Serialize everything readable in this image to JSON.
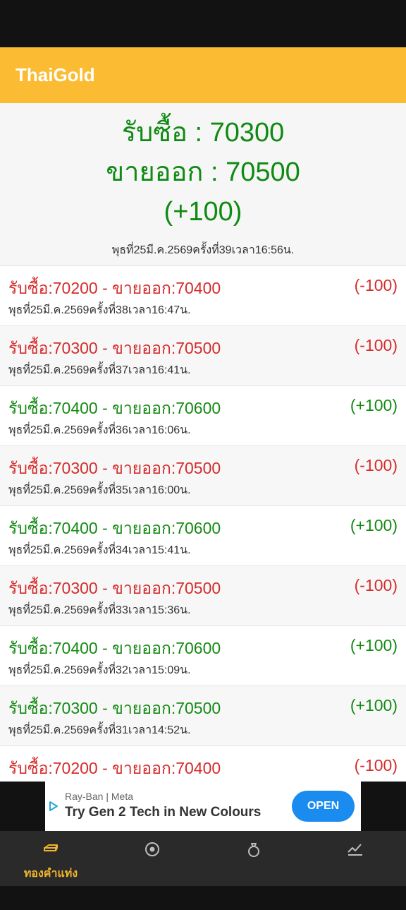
{
  "app": {
    "title": "ThaiGold"
  },
  "summary": {
    "buy": "รับซื้อ : 70300",
    "sell": "ขายออก : 70500",
    "change": "(+100)",
    "timestamp": "พุธที่25มี.ค.2569ครั้งที่39เวลา16:56น."
  },
  "history": [
    {
      "prices": "รับซื้อ:70200 - ขายออก:70400",
      "change": "(-100)",
      "timestamp": "พุธที่25มี.ค.2569ครั้งที่38เวลา16:47น.",
      "direction": "down"
    },
    {
      "prices": "รับซื้อ:70300 - ขายออก:70500",
      "change": "(-100)",
      "timestamp": "พุธที่25มี.ค.2569ครั้งที่37เวลา16:41น.",
      "direction": "down"
    },
    {
      "prices": "รับซื้อ:70400 - ขายออก:70600",
      "change": "(+100)",
      "timestamp": "พุธที่25มี.ค.2569ครั้งที่36เวลา16:06น.",
      "direction": "up"
    },
    {
      "prices": "รับซื้อ:70300 - ขายออก:70500",
      "change": "(-100)",
      "timestamp": "พุธที่25มี.ค.2569ครั้งที่35เวลา16:00น.",
      "direction": "down"
    },
    {
      "prices": "รับซื้อ:70400 - ขายออก:70600",
      "change": "(+100)",
      "timestamp": "พุธที่25มี.ค.2569ครั้งที่34เวลา15:41น.",
      "direction": "up"
    },
    {
      "prices": "รับซื้อ:70300 - ขายออก:70500",
      "change": "(-100)",
      "timestamp": "พุธที่25มี.ค.2569ครั้งที่33เวลา15:36น.",
      "direction": "down"
    },
    {
      "prices": "รับซื้อ:70400 - ขายออก:70600",
      "change": "(+100)",
      "timestamp": "พุธที่25มี.ค.2569ครั้งที่32เวลา15:09น.",
      "direction": "up"
    },
    {
      "prices": "รับซื้อ:70300 - ขายออก:70500",
      "change": "(+100)",
      "timestamp": "พุธที่25มี.ค.2569ครั้งที่31เวลา14:52น.",
      "direction": "up"
    },
    {
      "prices": "รับซื้อ:70200 - ขายออก:70400",
      "change": "(-100)",
      "timestamp": "",
      "direction": "down"
    }
  ],
  "ad": {
    "advertiser": "Ray-Ban | Meta",
    "headline": "Try Gen 2 Tech in New Colours",
    "cta": "OPEN"
  },
  "nav": {
    "tabs": [
      {
        "label": "ทองคำแท่ง",
        "icon": "gold-bar-icon",
        "active": true
      },
      {
        "label": "",
        "icon": "coin-icon",
        "active": false
      },
      {
        "label": "",
        "icon": "ring-icon",
        "active": false
      },
      {
        "label": "",
        "icon": "chart-icon",
        "active": false
      }
    ]
  },
  "colors": {
    "accent": "#fbbb33",
    "up": "#138a13",
    "down": "#d52b2b",
    "nav_active": "#f1b52c",
    "nav_inactive": "#bdbdbd"
  }
}
